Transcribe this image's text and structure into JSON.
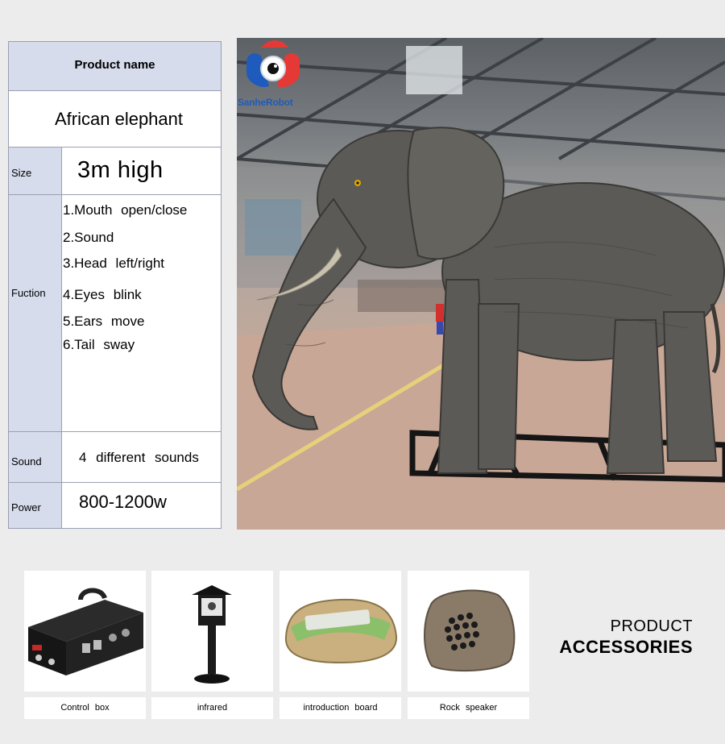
{
  "spec_table": {
    "header": "Product  name",
    "product_name": "African elephant",
    "size": {
      "label": "Size",
      "value": "3m   high"
    },
    "function": {
      "label": "Fuction",
      "items": [
        "1.Mouth  open/close",
        "2.Sound",
        "3.Head  left/right",
        "4.Eyes  blink",
        "5.Ears  move",
        "6.Tail  sway"
      ]
    },
    "sound": {
      "label": "Sound",
      "value": "4  different  sounds"
    },
    "power": {
      "label": "Power",
      "value": "800-1200w"
    }
  },
  "hero": {
    "logo_text": "SanheRobot",
    "logo_icon": "eye-logo-icon"
  },
  "accessories": {
    "title_line1": "PRODUCT",
    "title_line2": "ACCESSORIES",
    "items": [
      {
        "caption": "Control  box",
        "icon": "control-box-icon"
      },
      {
        "caption": "infrared",
        "icon": "infrared-sensor-icon"
      },
      {
        "caption": "introduction  board",
        "icon": "intro-board-icon"
      },
      {
        "caption": "Rock  speaker",
        "icon": "rock-speaker-icon"
      }
    ]
  },
  "colors": {
    "page_bg": "#ececec",
    "label_bg": "#d6dcec",
    "border": "#9aa0b3",
    "logo_red": "#e53935",
    "logo_blue": "#1e5bbd"
  }
}
